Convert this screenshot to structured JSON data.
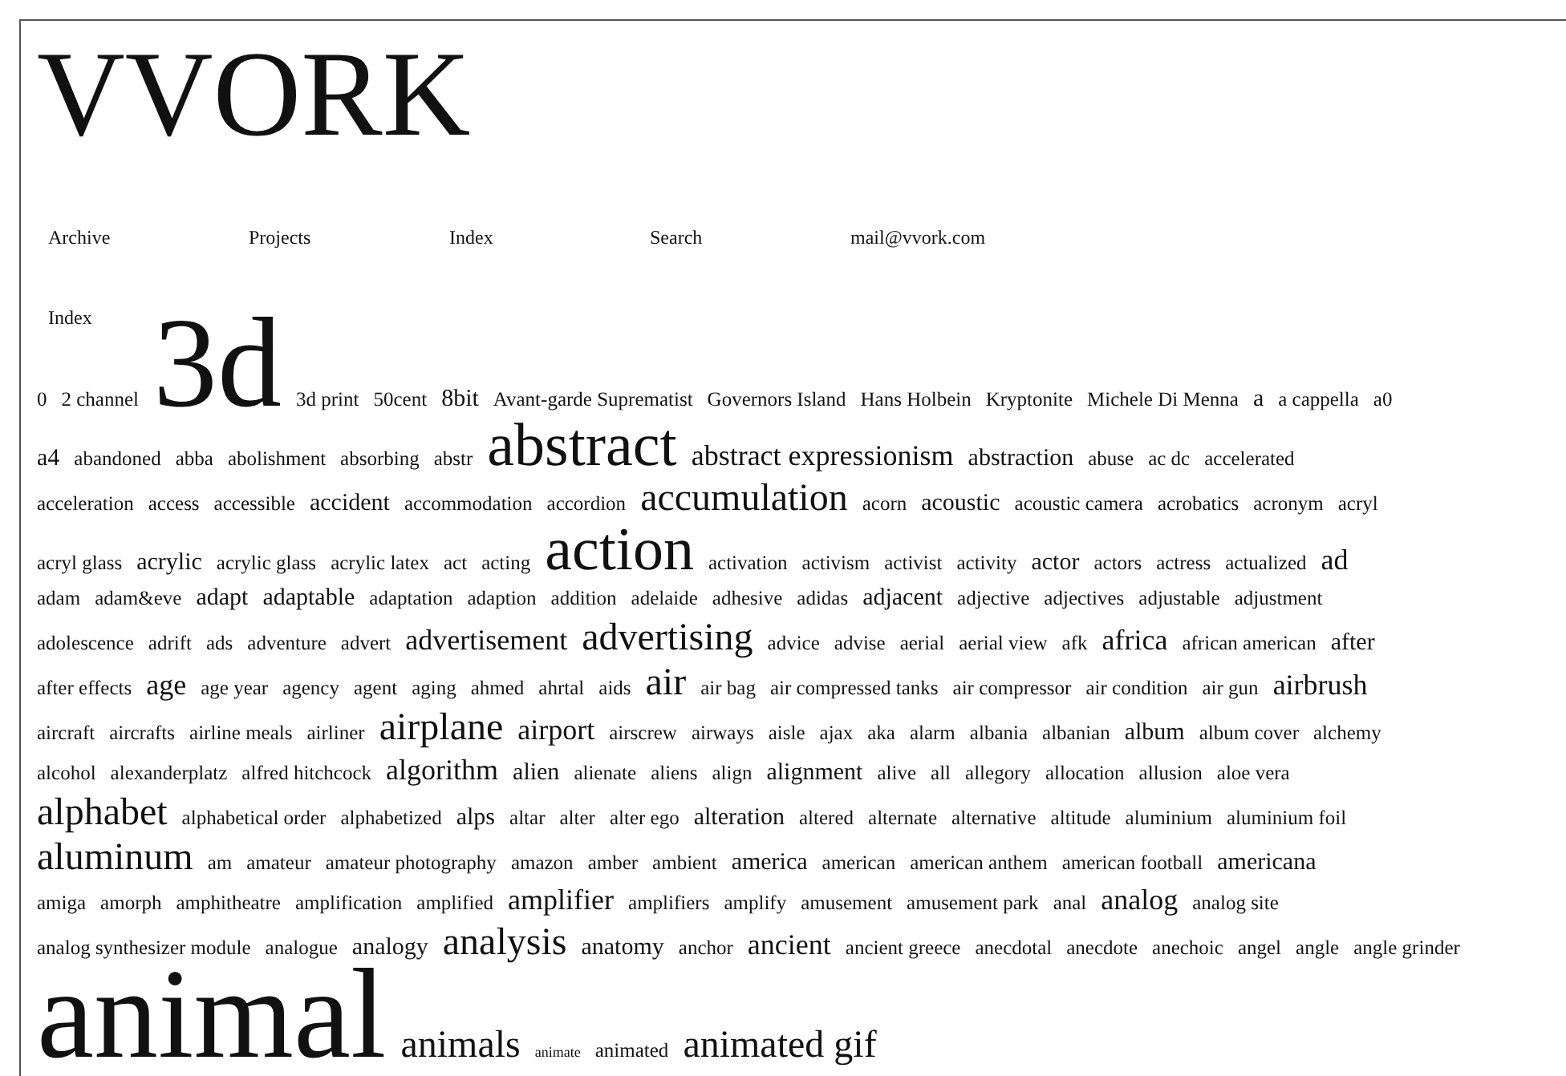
{
  "logo": "VVORK",
  "nav": [
    "Archive",
    "Projects",
    "Index",
    "Search",
    "mail@vvork.com"
  ],
  "section_title": "Index",
  "tag_rows": [
    [
      {
        "text": "0",
        "kind": "s"
      },
      {
        "text": "2 channel",
        "kind": "s"
      },
      {
        "text": "3d",
        "kind": "giant"
      },
      {
        "text": "3d print",
        "kind": "s"
      },
      {
        "text": "50cent",
        "kind": "s"
      },
      {
        "text": "8bit",
        "kind": "m"
      },
      {
        "text": "Avant-garde Suprematist",
        "kind": "s"
      },
      {
        "text": "Governors Island",
        "kind": "s"
      },
      {
        "text": "Hans Holbein",
        "kind": "s"
      },
      {
        "text": "Kryptonite",
        "kind": "s"
      },
      {
        "text": "Michele Di Menna",
        "kind": "s"
      },
      {
        "text": "a",
        "kind": "m"
      },
      {
        "text": "a cappella",
        "kind": "s"
      },
      {
        "text": "a0",
        "kind": "s"
      }
    ],
    [
      {
        "text": "a4",
        "kind": "m"
      },
      {
        "text": "abandoned",
        "kind": "s"
      },
      {
        "text": "abba",
        "kind": "s"
      },
      {
        "text": "abolishment",
        "kind": "s"
      },
      {
        "text": "absorbing",
        "kind": "s"
      },
      {
        "text": "abstr",
        "kind": "s"
      },
      {
        "text": "abstract",
        "kind": "huge"
      },
      {
        "text": "abstract expressionism",
        "kind": "l"
      },
      {
        "text": "abstraction",
        "kind": "m"
      },
      {
        "text": "abuse",
        "kind": "s"
      },
      {
        "text": "ac dc",
        "kind": "s"
      },
      {
        "text": "accelerated",
        "kind": "s"
      }
    ],
    [
      {
        "text": "acceleration",
        "kind": "s"
      },
      {
        "text": "access",
        "kind": "s"
      },
      {
        "text": "accessible",
        "kind": "s"
      },
      {
        "text": "accident",
        "kind": "m"
      },
      {
        "text": "accommodation",
        "kind": "s"
      },
      {
        "text": "accordion",
        "kind": "s"
      },
      {
        "text": "accumulation",
        "kind": "xl"
      },
      {
        "text": "acorn",
        "kind": "s"
      },
      {
        "text": "acoustic",
        "kind": "m"
      },
      {
        "text": "acoustic camera",
        "kind": "s"
      },
      {
        "text": "acrobatics",
        "kind": "s"
      },
      {
        "text": "acronym",
        "kind": "s"
      },
      {
        "text": "acryl",
        "kind": "s"
      }
    ],
    [
      {
        "text": "acryl glass",
        "kind": "s"
      },
      {
        "text": "acrylic",
        "kind": "m"
      },
      {
        "text": "acrylic glass",
        "kind": "s"
      },
      {
        "text": "acrylic latex",
        "kind": "s"
      },
      {
        "text": "act",
        "kind": "s"
      },
      {
        "text": "acting",
        "kind": "s"
      },
      {
        "text": "action",
        "kind": "huge"
      },
      {
        "text": "activation",
        "kind": "s"
      },
      {
        "text": "activism",
        "kind": "s"
      },
      {
        "text": "activist",
        "kind": "s"
      },
      {
        "text": "activity",
        "kind": "s"
      },
      {
        "text": "actor",
        "kind": "m"
      },
      {
        "text": "actors",
        "kind": "s"
      },
      {
        "text": "actress",
        "kind": "s"
      },
      {
        "text": "actualized",
        "kind": "s"
      },
      {
        "text": "ad",
        "kind": "l"
      }
    ],
    [
      {
        "text": "adam",
        "kind": "s"
      },
      {
        "text": "adam&eve",
        "kind": "s"
      },
      {
        "text": "adapt",
        "kind": "m"
      },
      {
        "text": "adaptable",
        "kind": "m"
      },
      {
        "text": "adaptation",
        "kind": "s"
      },
      {
        "text": "adaption",
        "kind": "s"
      },
      {
        "text": "addition",
        "kind": "s"
      },
      {
        "text": "adelaide",
        "kind": "s"
      },
      {
        "text": "adhesive",
        "kind": "s"
      },
      {
        "text": "adidas",
        "kind": "s"
      },
      {
        "text": "adjacent",
        "kind": "m"
      },
      {
        "text": "adjective",
        "kind": "s"
      },
      {
        "text": "adjectives",
        "kind": "s"
      },
      {
        "text": "adjustable",
        "kind": "s"
      },
      {
        "text": "adjustment",
        "kind": "s"
      }
    ],
    [
      {
        "text": "adolescence",
        "kind": "s"
      },
      {
        "text": "adrift",
        "kind": "s"
      },
      {
        "text": "ads",
        "kind": "s"
      },
      {
        "text": "adventure",
        "kind": "s"
      },
      {
        "text": "advert",
        "kind": "s"
      },
      {
        "text": "advertisement",
        "kind": "l"
      },
      {
        "text": "advertising",
        "kind": "xl"
      },
      {
        "text": "advice",
        "kind": "s"
      },
      {
        "text": "advise",
        "kind": "s"
      },
      {
        "text": "aerial",
        "kind": "s"
      },
      {
        "text": "aerial view",
        "kind": "s"
      },
      {
        "text": "afk",
        "kind": "s"
      },
      {
        "text": "africa",
        "kind": "l"
      },
      {
        "text": "african american",
        "kind": "s"
      },
      {
        "text": "after",
        "kind": "m"
      }
    ],
    [
      {
        "text": "after effects",
        "kind": "s"
      },
      {
        "text": "age",
        "kind": "l"
      },
      {
        "text": "age year",
        "kind": "s"
      },
      {
        "text": "agency",
        "kind": "s"
      },
      {
        "text": "agent",
        "kind": "s"
      },
      {
        "text": "aging",
        "kind": "s"
      },
      {
        "text": "ahmed",
        "kind": "s"
      },
      {
        "text": "ahrtal",
        "kind": "s"
      },
      {
        "text": "aids",
        "kind": "s"
      },
      {
        "text": "air",
        "kind": "xl"
      },
      {
        "text": "air bag",
        "kind": "s"
      },
      {
        "text": "air compressed tanks",
        "kind": "s"
      },
      {
        "text": "air compressor",
        "kind": "s"
      },
      {
        "text": "air condition",
        "kind": "s"
      },
      {
        "text": "air gun",
        "kind": "s"
      },
      {
        "text": "airbrush",
        "kind": "l"
      }
    ],
    [
      {
        "text": "aircraft",
        "kind": "s"
      },
      {
        "text": "aircrafts",
        "kind": "s"
      },
      {
        "text": "airline meals",
        "kind": "s"
      },
      {
        "text": "airliner",
        "kind": "s"
      },
      {
        "text": "airplane",
        "kind": "xl"
      },
      {
        "text": "airport",
        "kind": "l"
      },
      {
        "text": "airscrew",
        "kind": "s"
      },
      {
        "text": "airways",
        "kind": "s"
      },
      {
        "text": "aisle",
        "kind": "s"
      },
      {
        "text": "ajax",
        "kind": "s"
      },
      {
        "text": "aka",
        "kind": "s"
      },
      {
        "text": "alarm",
        "kind": "s"
      },
      {
        "text": "albania",
        "kind": "s"
      },
      {
        "text": "albanian",
        "kind": "s"
      },
      {
        "text": "album",
        "kind": "m"
      },
      {
        "text": "album cover",
        "kind": "s"
      },
      {
        "text": "alchemy",
        "kind": "s"
      }
    ],
    [
      {
        "text": "alcohol",
        "kind": "s"
      },
      {
        "text": "alexanderplatz",
        "kind": "s"
      },
      {
        "text": "alfred hitchcock",
        "kind": "s"
      },
      {
        "text": "algorithm",
        "kind": "l"
      },
      {
        "text": "alien",
        "kind": "m"
      },
      {
        "text": "alienate",
        "kind": "s"
      },
      {
        "text": "aliens",
        "kind": "s"
      },
      {
        "text": "align",
        "kind": "s"
      },
      {
        "text": "alignment",
        "kind": "m"
      },
      {
        "text": "alive",
        "kind": "s"
      },
      {
        "text": "all",
        "kind": "s"
      },
      {
        "text": "allegory",
        "kind": "s"
      },
      {
        "text": "allocation",
        "kind": "s"
      },
      {
        "text": "allusion",
        "kind": "s"
      },
      {
        "text": "aloe vera",
        "kind": "s"
      }
    ],
    [
      {
        "text": "alphabet",
        "kind": "xl"
      },
      {
        "text": "alphabetical order",
        "kind": "s"
      },
      {
        "text": "alphabetized",
        "kind": "s"
      },
      {
        "text": "alps",
        "kind": "m"
      },
      {
        "text": "altar",
        "kind": "s"
      },
      {
        "text": "alter",
        "kind": "s"
      },
      {
        "text": "alter ego",
        "kind": "s"
      },
      {
        "text": "alteration",
        "kind": "m"
      },
      {
        "text": "altered",
        "kind": "s"
      },
      {
        "text": "alternate",
        "kind": "s"
      },
      {
        "text": "alternative",
        "kind": "s"
      },
      {
        "text": "altitude",
        "kind": "s"
      },
      {
        "text": "aluminium",
        "kind": "s"
      },
      {
        "text": "aluminium foil",
        "kind": "s"
      }
    ],
    [
      {
        "text": "aluminum",
        "kind": "xl"
      },
      {
        "text": "am",
        "kind": "s"
      },
      {
        "text": "amateur",
        "kind": "s"
      },
      {
        "text": "amateur photography",
        "kind": "s"
      },
      {
        "text": "amazon",
        "kind": "s"
      },
      {
        "text": "amber",
        "kind": "s"
      },
      {
        "text": "ambient",
        "kind": "s"
      },
      {
        "text": "america",
        "kind": "m"
      },
      {
        "text": "american",
        "kind": "s"
      },
      {
        "text": "american anthem",
        "kind": "s"
      },
      {
        "text": "american football",
        "kind": "s"
      },
      {
        "text": "americana",
        "kind": "m"
      }
    ],
    [
      {
        "text": "amiga",
        "kind": "s"
      },
      {
        "text": "amorph",
        "kind": "s"
      },
      {
        "text": "amphitheatre",
        "kind": "s"
      },
      {
        "text": "amplification",
        "kind": "s"
      },
      {
        "text": "amplified",
        "kind": "s"
      },
      {
        "text": "amplifier",
        "kind": "l"
      },
      {
        "text": "amplifiers",
        "kind": "s"
      },
      {
        "text": "amplify",
        "kind": "s"
      },
      {
        "text": "amusement",
        "kind": "s"
      },
      {
        "text": "amusement park",
        "kind": "s"
      },
      {
        "text": "anal",
        "kind": "s"
      },
      {
        "text": "analog",
        "kind": "l"
      },
      {
        "text": "analog site",
        "kind": "s"
      }
    ],
    [
      {
        "text": "analog synthesizer module",
        "kind": "s"
      },
      {
        "text": "analogue",
        "kind": "s"
      },
      {
        "text": "analogy",
        "kind": "m"
      },
      {
        "text": "analysis",
        "kind": "xl"
      },
      {
        "text": "anatomy",
        "kind": "m"
      },
      {
        "text": "anchor",
        "kind": "s"
      },
      {
        "text": "ancient",
        "kind": "l"
      },
      {
        "text": "ancient greece",
        "kind": "s"
      },
      {
        "text": "anecdotal",
        "kind": "s"
      },
      {
        "text": "anecdote",
        "kind": "s"
      },
      {
        "text": "anechoic",
        "kind": "s"
      },
      {
        "text": "angel",
        "kind": "s"
      },
      {
        "text": "angle",
        "kind": "s"
      },
      {
        "text": "angle grinder",
        "kind": "s"
      }
    ],
    [
      {
        "text": "animal",
        "kind": "giant"
      },
      {
        "text": "animals",
        "kind": "xl"
      },
      {
        "text": "animate",
        "kind": "xs"
      },
      {
        "text": "animated",
        "kind": "s"
      },
      {
        "text": "animated gif",
        "kind": "xl"
      }
    ]
  ]
}
